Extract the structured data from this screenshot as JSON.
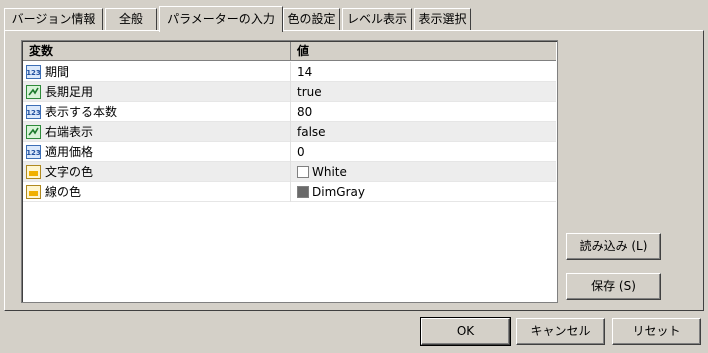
{
  "tabs": [
    {
      "label": "バージョン情報"
    },
    {
      "label": "全般"
    },
    {
      "label": "パラメーターの入力"
    },
    {
      "label": "色の設定"
    },
    {
      "label": "レベル表示"
    },
    {
      "label": "表示選択"
    }
  ],
  "grid": {
    "headers": {
      "name": "変数",
      "value": "値"
    },
    "rows": [
      {
        "icon": "numeric-123-icon",
        "name": "期間",
        "value": "14"
      },
      {
        "icon": "boolean-icon",
        "name": "長期足用",
        "value": "true"
      },
      {
        "icon": "numeric-123-icon",
        "name": "表示する本数",
        "value": "80"
      },
      {
        "icon": "boolean-icon",
        "name": "右端表示",
        "value": "false"
      },
      {
        "icon": "numeric-123-icon",
        "name": "適用価格",
        "value": "0"
      },
      {
        "icon": "color-icon",
        "name": "文字の色",
        "value": "White",
        "color": "#ffffff"
      },
      {
        "icon": "color-icon",
        "name": "線の色",
        "value": "DimGray",
        "color": "#696969"
      }
    ]
  },
  "buttons": {
    "load": "読み込み (L)",
    "save": "保存 (S)",
    "ok": "OK",
    "cancel": "キャンセル",
    "reset": "リセット"
  }
}
